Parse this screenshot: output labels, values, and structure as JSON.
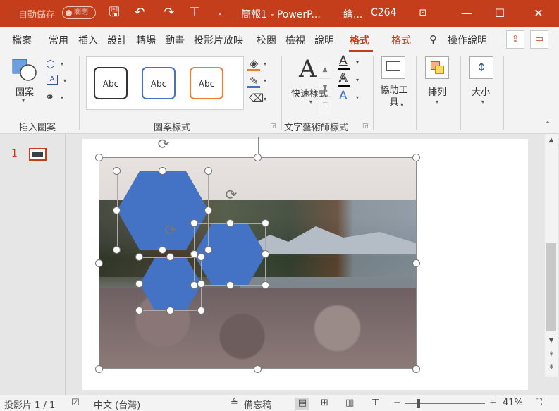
{
  "titlebar": {
    "autosave_label": "自動儲存",
    "autosave_state": "關閉",
    "doc_title": "簡報1  -  PowerP...",
    "user_label": "繪...",
    "user_code": "C264",
    "accent_color": "#c43e1c"
  },
  "tabs": [
    {
      "label": "檔案"
    },
    {
      "label": "常用"
    },
    {
      "label": "插入"
    },
    {
      "label": "設計"
    },
    {
      "label": "轉場"
    },
    {
      "label": "動畫"
    },
    {
      "label": "投影片放映"
    },
    {
      "label": "校閱"
    },
    {
      "label": "檢視"
    },
    {
      "label": "說明"
    },
    {
      "label": "格式",
      "active": true
    },
    {
      "label": "格式"
    }
  ],
  "tell_me": "操作說明",
  "ribbon": {
    "insert_shapes": {
      "shapes_label": "圖案",
      "group_label": "插入圖案"
    },
    "shape_styles": {
      "group_label": "圖案樣式",
      "style_samples": [
        "Abc",
        "Abc",
        "Abc"
      ]
    },
    "wordart": {
      "quick_styles_label": "快速樣式",
      "group_label": "文字藝術師樣式"
    },
    "accessibility_label": "協助工具",
    "arrange_label": "排列",
    "size_label": "大小"
  },
  "slide_panel": {
    "slide_number": "1"
  },
  "statusbar": {
    "slide_info": "投影片 1 / 1",
    "language": "中文 (台灣)",
    "notes_label": "備忘稿",
    "zoom": "41%"
  }
}
